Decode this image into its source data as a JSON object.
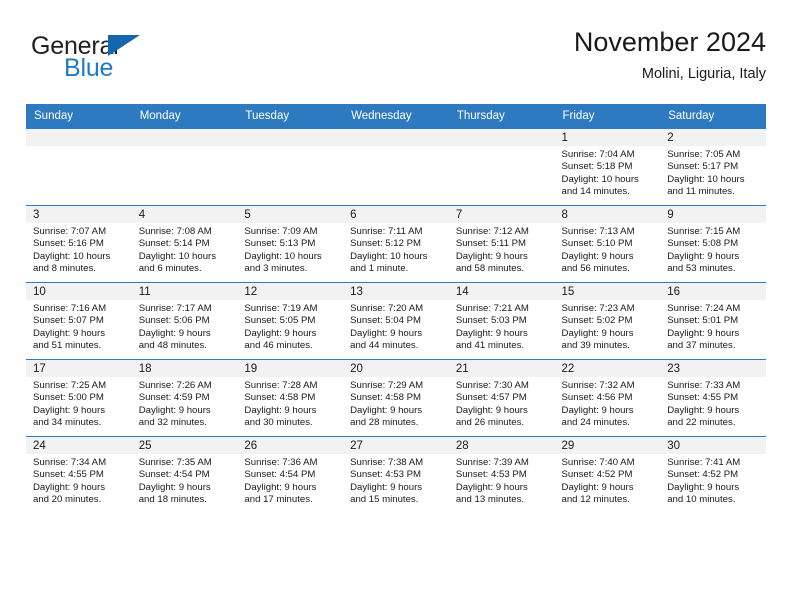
{
  "brand": {
    "line1": "General",
    "line2": "Blue",
    "flag_icon": "triangle-flag-icon",
    "color_dark": "#231f20",
    "color_blue": "#1f7ac4",
    "flag_color": "#1566ac"
  },
  "header": {
    "title": "November 2024",
    "subtitle": "Molini, Liguria, Italy"
  },
  "theme": {
    "header_blue": "#2e7ac0",
    "daynum_strip": "#f2f2f2",
    "text": "#1a1a1a"
  },
  "weekdays": [
    "Sunday",
    "Monday",
    "Tuesday",
    "Wednesday",
    "Thursday",
    "Friday",
    "Saturday"
  ],
  "weeks": [
    [
      {
        "day": "",
        "sunrise": "",
        "sunset": "",
        "daylight1": "",
        "daylight2": ""
      },
      {
        "day": "",
        "sunrise": "",
        "sunset": "",
        "daylight1": "",
        "daylight2": ""
      },
      {
        "day": "",
        "sunrise": "",
        "sunset": "",
        "daylight1": "",
        "daylight2": ""
      },
      {
        "day": "",
        "sunrise": "",
        "sunset": "",
        "daylight1": "",
        "daylight2": ""
      },
      {
        "day": "",
        "sunrise": "",
        "sunset": "",
        "daylight1": "",
        "daylight2": ""
      },
      {
        "day": "1",
        "sunrise": "Sunrise: 7:04 AM",
        "sunset": "Sunset: 5:18 PM",
        "daylight1": "Daylight: 10 hours",
        "daylight2": "and 14 minutes."
      },
      {
        "day": "2",
        "sunrise": "Sunrise: 7:05 AM",
        "sunset": "Sunset: 5:17 PM",
        "daylight1": "Daylight: 10 hours",
        "daylight2": "and 11 minutes."
      }
    ],
    [
      {
        "day": "3",
        "sunrise": "Sunrise: 7:07 AM",
        "sunset": "Sunset: 5:16 PM",
        "daylight1": "Daylight: 10 hours",
        "daylight2": "and 8 minutes."
      },
      {
        "day": "4",
        "sunrise": "Sunrise: 7:08 AM",
        "sunset": "Sunset: 5:14 PM",
        "daylight1": "Daylight: 10 hours",
        "daylight2": "and 6 minutes."
      },
      {
        "day": "5",
        "sunrise": "Sunrise: 7:09 AM",
        "sunset": "Sunset: 5:13 PM",
        "daylight1": "Daylight: 10 hours",
        "daylight2": "and 3 minutes."
      },
      {
        "day": "6",
        "sunrise": "Sunrise: 7:11 AM",
        "sunset": "Sunset: 5:12 PM",
        "daylight1": "Daylight: 10 hours",
        "daylight2": "and 1 minute."
      },
      {
        "day": "7",
        "sunrise": "Sunrise: 7:12 AM",
        "sunset": "Sunset: 5:11 PM",
        "daylight1": "Daylight: 9 hours",
        "daylight2": "and 58 minutes."
      },
      {
        "day": "8",
        "sunrise": "Sunrise: 7:13 AM",
        "sunset": "Sunset: 5:10 PM",
        "daylight1": "Daylight: 9 hours",
        "daylight2": "and 56 minutes."
      },
      {
        "day": "9",
        "sunrise": "Sunrise: 7:15 AM",
        "sunset": "Sunset: 5:08 PM",
        "daylight1": "Daylight: 9 hours",
        "daylight2": "and 53 minutes."
      }
    ],
    [
      {
        "day": "10",
        "sunrise": "Sunrise: 7:16 AM",
        "sunset": "Sunset: 5:07 PM",
        "daylight1": "Daylight: 9 hours",
        "daylight2": "and 51 minutes."
      },
      {
        "day": "11",
        "sunrise": "Sunrise: 7:17 AM",
        "sunset": "Sunset: 5:06 PM",
        "daylight1": "Daylight: 9 hours",
        "daylight2": "and 48 minutes."
      },
      {
        "day": "12",
        "sunrise": "Sunrise: 7:19 AM",
        "sunset": "Sunset: 5:05 PM",
        "daylight1": "Daylight: 9 hours",
        "daylight2": "and 46 minutes."
      },
      {
        "day": "13",
        "sunrise": "Sunrise: 7:20 AM",
        "sunset": "Sunset: 5:04 PM",
        "daylight1": "Daylight: 9 hours",
        "daylight2": "and 44 minutes."
      },
      {
        "day": "14",
        "sunrise": "Sunrise: 7:21 AM",
        "sunset": "Sunset: 5:03 PM",
        "daylight1": "Daylight: 9 hours",
        "daylight2": "and 41 minutes."
      },
      {
        "day": "15",
        "sunrise": "Sunrise: 7:23 AM",
        "sunset": "Sunset: 5:02 PM",
        "daylight1": "Daylight: 9 hours",
        "daylight2": "and 39 minutes."
      },
      {
        "day": "16",
        "sunrise": "Sunrise: 7:24 AM",
        "sunset": "Sunset: 5:01 PM",
        "daylight1": "Daylight: 9 hours",
        "daylight2": "and 37 minutes."
      }
    ],
    [
      {
        "day": "17",
        "sunrise": "Sunrise: 7:25 AM",
        "sunset": "Sunset: 5:00 PM",
        "daylight1": "Daylight: 9 hours",
        "daylight2": "and 34 minutes."
      },
      {
        "day": "18",
        "sunrise": "Sunrise: 7:26 AM",
        "sunset": "Sunset: 4:59 PM",
        "daylight1": "Daylight: 9 hours",
        "daylight2": "and 32 minutes."
      },
      {
        "day": "19",
        "sunrise": "Sunrise: 7:28 AM",
        "sunset": "Sunset: 4:58 PM",
        "daylight1": "Daylight: 9 hours",
        "daylight2": "and 30 minutes."
      },
      {
        "day": "20",
        "sunrise": "Sunrise: 7:29 AM",
        "sunset": "Sunset: 4:58 PM",
        "daylight1": "Daylight: 9 hours",
        "daylight2": "and 28 minutes."
      },
      {
        "day": "21",
        "sunrise": "Sunrise: 7:30 AM",
        "sunset": "Sunset: 4:57 PM",
        "daylight1": "Daylight: 9 hours",
        "daylight2": "and 26 minutes."
      },
      {
        "day": "22",
        "sunrise": "Sunrise: 7:32 AM",
        "sunset": "Sunset: 4:56 PM",
        "daylight1": "Daylight: 9 hours",
        "daylight2": "and 24 minutes."
      },
      {
        "day": "23",
        "sunrise": "Sunrise: 7:33 AM",
        "sunset": "Sunset: 4:55 PM",
        "daylight1": "Daylight: 9 hours",
        "daylight2": "and 22 minutes."
      }
    ],
    [
      {
        "day": "24",
        "sunrise": "Sunrise: 7:34 AM",
        "sunset": "Sunset: 4:55 PM",
        "daylight1": "Daylight: 9 hours",
        "daylight2": "and 20 minutes."
      },
      {
        "day": "25",
        "sunrise": "Sunrise: 7:35 AM",
        "sunset": "Sunset: 4:54 PM",
        "daylight1": "Daylight: 9 hours",
        "daylight2": "and 18 minutes."
      },
      {
        "day": "26",
        "sunrise": "Sunrise: 7:36 AM",
        "sunset": "Sunset: 4:54 PM",
        "daylight1": "Daylight: 9 hours",
        "daylight2": "and 17 minutes."
      },
      {
        "day": "27",
        "sunrise": "Sunrise: 7:38 AM",
        "sunset": "Sunset: 4:53 PM",
        "daylight1": "Daylight: 9 hours",
        "daylight2": "and 15 minutes."
      },
      {
        "day": "28",
        "sunrise": "Sunrise: 7:39 AM",
        "sunset": "Sunset: 4:53 PM",
        "daylight1": "Daylight: 9 hours",
        "daylight2": "and 13 minutes."
      },
      {
        "day": "29",
        "sunrise": "Sunrise: 7:40 AM",
        "sunset": "Sunset: 4:52 PM",
        "daylight1": "Daylight: 9 hours",
        "daylight2": "and 12 minutes."
      },
      {
        "day": "30",
        "sunrise": "Sunrise: 7:41 AM",
        "sunset": "Sunset: 4:52 PM",
        "daylight1": "Daylight: 9 hours",
        "daylight2": "and 10 minutes."
      }
    ]
  ]
}
